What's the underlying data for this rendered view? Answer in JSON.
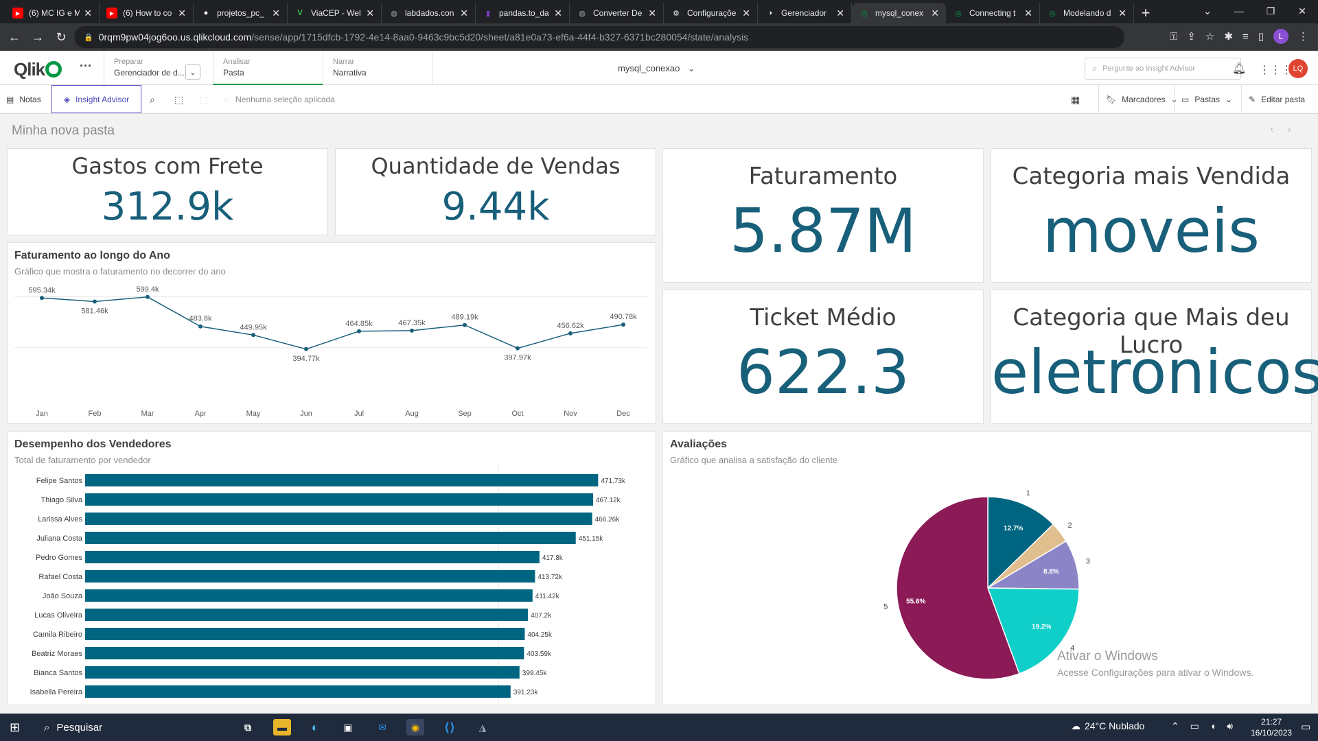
{
  "browser": {
    "tabs": [
      {
        "title": "(6) MC IG e M",
        "icon": "youtube-icon",
        "color": "#ff0000"
      },
      {
        "title": "(6) How to co",
        "icon": "youtube-icon",
        "color": "#ff0000"
      },
      {
        "title": "projetos_pc_",
        "icon": "github-icon",
        "color": "#ffffff"
      },
      {
        "title": "ViaCEP - Wel",
        "icon": "viacep-icon",
        "color": "#2ecc40"
      },
      {
        "title": "labdados.con",
        "icon": "globe-icon",
        "color": "#9aa0a6"
      },
      {
        "title": "pandas.to_da",
        "icon": "pandas-icon",
        "color": "#7a3cc4"
      },
      {
        "title": "Converter De",
        "icon": "openai-icon",
        "color": "#9aa0a6"
      },
      {
        "title": "Configuraçõe",
        "icon": "gear-icon",
        "color": "#e8eaed"
      },
      {
        "title": "Gerenciador",
        "icon": "toggle-icon",
        "color": "#e8eaed"
      },
      {
        "title": "mysql_conex",
        "icon": "qlik-icon",
        "color": "#009845",
        "active": true
      },
      {
        "title": "Connecting t",
        "icon": "qlik-icon",
        "color": "#009845"
      },
      {
        "title": "Modelando d",
        "icon": "qlik-icon",
        "color": "#009845"
      }
    ],
    "url_host": "0rqm9pw04jog6oo.us.qlikcloud.com",
    "url_path": "/sense/app/1715dfcb-1792-4e14-8aa0-9463c9bc5d20/sheet/a81e0a73-ef6a-44f4-b327-6371bc280054/state/analysis",
    "profile_initial": "L"
  },
  "qlik": {
    "logo": "Qlik",
    "sections": [
      {
        "label": "Preparar",
        "value": "Gerenciador de d..."
      },
      {
        "label": "Analisar",
        "value": "Pasta"
      },
      {
        "label": "Narrar",
        "value": "Narrativa"
      }
    ],
    "app_title": "mysql_conexao",
    "search_placeholder": "Pergunte ao Insight Advisor",
    "user_initials": "LQ",
    "toolbar": {
      "notes": "Notas",
      "insight": "Insight Advisor",
      "no_selection": "Nenhuma seleção aplicada",
      "bookmarks": "Marcadores",
      "sheets": "Pastas",
      "edit": "Editar pasta"
    },
    "sheet_title": "Minha nova pasta"
  },
  "kpis": {
    "frete": {
      "title": "Gastos com Frete",
      "value": "312.9k"
    },
    "vendas": {
      "title": "Quantidade de Vendas",
      "value": "9.44k"
    },
    "faturamento": {
      "title": "Faturamento",
      "value": "5.87M"
    },
    "categoria": {
      "title": "Categoria mais Vendida",
      "value": "moveis"
    },
    "ticket": {
      "title": "Ticket Médio",
      "value": "622.3"
    },
    "lucro": {
      "title": "Categoria que Mais deu Lucro",
      "value": "eletronicos"
    }
  },
  "line_card": {
    "title": "Faturamento ao longo do Ano",
    "subtitle": "Gráfico que mostra o faturamento no decorrer do ano"
  },
  "bar_card": {
    "title": "Desempenho dos Vendedores",
    "subtitle": "Total de faturamento por vendedor"
  },
  "pie_card": {
    "title": "Avaliações",
    "subtitle": "Gráfico que analisa a satisfação do cliente"
  },
  "chart_data": [
    {
      "type": "line",
      "title": "Faturamento ao longo do Ano",
      "categories": [
        "Jan",
        "Feb",
        "Mar",
        "Apr",
        "May",
        "Jun",
        "Jul",
        "Aug",
        "Sep",
        "Oct",
        "Nov",
        "Dec"
      ],
      "values": [
        595340,
        581460,
        599400,
        483800,
        449950,
        394770,
        464850,
        467350,
        489190,
        397970,
        456620,
        490780
      ],
      "labels": [
        "595.34k",
        "581.46k",
        "599.4k",
        "483.8k",
        "449.95k",
        "394.77k",
        "464.85k",
        "467.35k",
        "489.19k",
        "397.97k",
        "456.62k",
        "490.78k"
      ],
      "ylim": [
        300000,
        650000
      ],
      "color": "#185f7a"
    },
    {
      "type": "bar",
      "orientation": "horizontal",
      "title": "Desempenho dos Vendedores",
      "categories": [
        "Felipe Santos",
        "Thiago Silva",
        "Larissa Alves",
        "Juliana Costa",
        "Pedro Gomes",
        "Rafael Costa",
        "João Souza",
        "Lucas Oliveira",
        "Camila Ribeiro",
        "Beatriz Moraes",
        "Bianca Santos",
        "Isabella Pereira"
      ],
      "values": [
        471730,
        467120,
        466260,
        451150,
        417800,
        413720,
        411420,
        407200,
        404250,
        403590,
        399450,
        391230
      ],
      "labels": [
        "471.73k",
        "467.12k",
        "466.26k",
        "451.15k",
        "417.8k",
        "413.72k",
        "411.42k",
        "407.2k",
        "404.25k",
        "403.59k",
        "399.45k",
        "391.23k"
      ],
      "xlim": [
        0,
        480000
      ],
      "color": "#006580"
    },
    {
      "type": "pie",
      "title": "Avaliações",
      "slices": [
        {
          "label": "1",
          "value": 12.7,
          "pct": "12.7%",
          "color": "#006580"
        },
        {
          "label": "2",
          "value": 3.7,
          "pct": "",
          "color": "#e0be8e"
        },
        {
          "label": "3",
          "value": 8.8,
          "pct": "8.8%",
          "color": "#8b85c8"
        },
        {
          "label": "4",
          "value": 19.2,
          "pct": "19.2%",
          "color": "#10cfc9"
        },
        {
          "label": "5",
          "value": 55.6,
          "pct": "55.6%",
          "color": "#8b1a56"
        }
      ]
    }
  ],
  "watermark": {
    "title": "Ativar o Windows",
    "subtitle": "Acesse Configurações para ativar o Windows."
  },
  "taskbar": {
    "search": "Pesquisar",
    "weather": "24°C  Nublado",
    "time": "21:27",
    "date": "16/10/2023"
  }
}
